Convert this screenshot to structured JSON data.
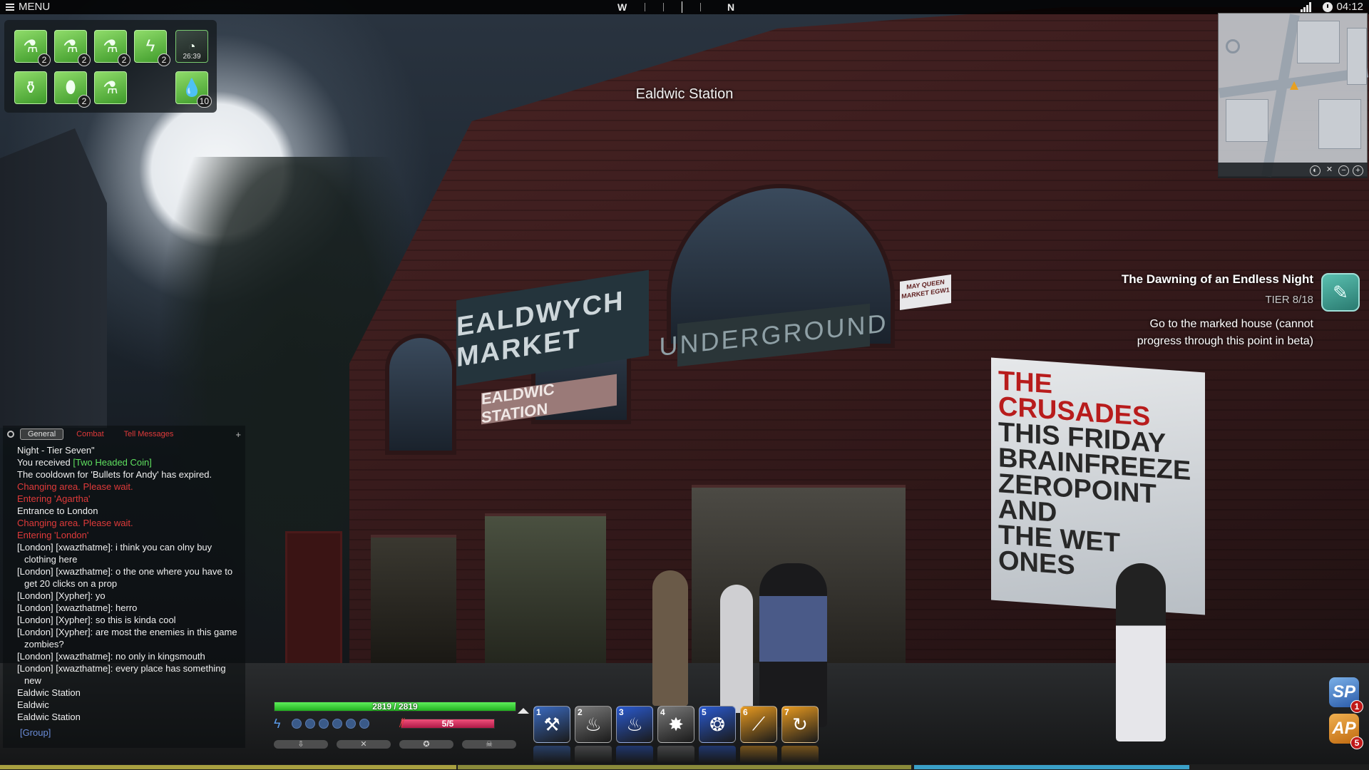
{
  "topbar": {
    "menu_label": "MENU",
    "compass": {
      "west": "W",
      "north": "N"
    },
    "clock": "04:12"
  },
  "location": {
    "name": "Ealdwic Station"
  },
  "scene_signs": {
    "market": "EALDWYCH MARKET",
    "station": "EALDWIC STATION",
    "underground": "UNDERGROUND",
    "street": "MAY QUEEN MARKET EGW1",
    "poster_red": "THE CRUSADES",
    "poster_lines": [
      "THIS FRIDAY",
      "BRAINFREEZE",
      "ZEROPOINT",
      "AND",
      "THE WET",
      "ONES"
    ]
  },
  "items": {
    "row1": [
      {
        "icon": "potion-icon",
        "count": "2"
      },
      {
        "icon": "potion-icon",
        "count": "2"
      },
      {
        "icon": "potion-icon",
        "count": "2"
      },
      {
        "icon": "lightning-icon",
        "count": "2"
      },
      {
        "icon": "timer-icon",
        "timer": "26:39"
      }
    ],
    "row2": [
      {
        "icon": "flask-icon"
      },
      {
        "icon": "capsule-icon",
        "count": "2"
      },
      {
        "icon": "vial-icon"
      },
      {
        "icon": "droplet-icon",
        "count": "10"
      }
    ]
  },
  "quest": {
    "title": "The Dawning of an Endless Night",
    "tier": "TIER 8/18",
    "description": "Go to the marked house (cannot progress through this point in beta)",
    "icon": "feather-icon"
  },
  "chat": {
    "tabs": [
      "General",
      "Combat",
      "Tell Messages"
    ],
    "active_tab": "General",
    "lines": [
      {
        "text": "Night - Tier Seven\"",
        "type": "normal"
      },
      {
        "prefix": "You received ",
        "link": "[Two Headed Coin]",
        "type": "loot"
      },
      {
        "text": "The cooldown for 'Bullets for Andy' has expired.",
        "type": "normal"
      },
      {
        "text": "Changing area. Please wait.",
        "type": "system"
      },
      {
        "text": "Entering 'Agartha'",
        "type": "system"
      },
      {
        "text": "Entrance to London",
        "type": "normal"
      },
      {
        "text": "Changing area. Please wait.",
        "type": "system"
      },
      {
        "text": "Entering 'London'",
        "type": "system"
      },
      {
        "text": "[London] [xwazthatme]: i think you can olny buy clothing here",
        "type": "normal"
      },
      {
        "text": "[London] [xwazthatme]: o the one where you have to get 20 clicks on a prop",
        "type": "normal"
      },
      {
        "text": "[London] [Xypher]: yo",
        "type": "normal"
      },
      {
        "text": "[London] [xwazthatme]: herro",
        "type": "normal"
      },
      {
        "text": "[London] [Xypher]: so this is kinda cool",
        "type": "normal"
      },
      {
        "text": "[London] [Xypher]: are most the enemies in this game zombies?",
        "type": "normal"
      },
      {
        "text": "[London] [xwazthatme]: no only in kingsmouth",
        "type": "normal"
      },
      {
        "text": "[London] [xwazthatme]: every place has something new",
        "type": "normal"
      },
      {
        "text": "Ealdwic Station",
        "type": "normal"
      },
      {
        "text": "Ealdwic",
        "type": "normal"
      },
      {
        "text": "Ealdwic Station",
        "type": "normal"
      }
    ],
    "input_placeholder": "[Group]"
  },
  "player": {
    "health_text": "2819 / 2819",
    "health_fraction": 1.0,
    "resource_text": "5/5",
    "resource_fraction": 1.0,
    "energy_pips": 6
  },
  "utility_bar": [
    {
      "icon": "down-arrow-icon",
      "glyph": "⇩"
    },
    {
      "icon": "crossed-swords-icon",
      "glyph": "✕"
    },
    {
      "icon": "star-icon",
      "glyph": "✪"
    },
    {
      "icon": "skull-icon",
      "glyph": "☠"
    }
  ],
  "abilities": [
    {
      "num": "1",
      "icon": "hammer-icon",
      "glyph": "⚒",
      "color": "#3a6ac0"
    },
    {
      "num": "2",
      "icon": "flame-icon",
      "glyph": "♨",
      "color": "#7a7a7a"
    },
    {
      "num": "3",
      "icon": "blue-fire-icon",
      "glyph": "♨",
      "color": "#2a5ad0"
    },
    {
      "num": "4",
      "icon": "explosion-icon",
      "glyph": "✸",
      "color": "#7a7a7a"
    },
    {
      "num": "5",
      "icon": "fire-ring-icon",
      "glyph": "❂",
      "color": "#2a5ad0"
    },
    {
      "num": "6",
      "icon": "slash-icon",
      "glyph": "⟋",
      "color": "#e89a20"
    },
    {
      "num": "7",
      "icon": "swirl-icon",
      "glyph": "↻",
      "color": "#e89a20"
    }
  ],
  "points": {
    "sp_label": "SP",
    "sp_count": "1",
    "ap_label": "AP",
    "ap_count": "5"
  },
  "colors": {
    "health": "#3ad83a",
    "resource": "#e03060",
    "chat_system": "#e03a3a",
    "chat_loot": "#5fe05f"
  }
}
